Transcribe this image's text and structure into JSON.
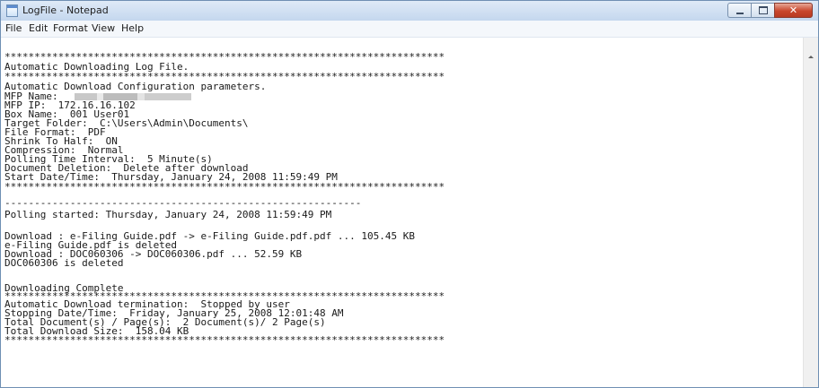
{
  "window": {
    "title": "LogFile - Notepad",
    "caption_buttons": {
      "minimize": "minimize-icon",
      "maximize": "maximize-icon",
      "close": "✕"
    }
  },
  "menu": [
    "File",
    "Edit",
    "Format",
    "View",
    "Help"
  ],
  "editor": {
    "lines": [
      "**************************************************************************",
      "Automatic Downloading Log File.",
      "**************************************************************************",
      "Automatic Download Configuration parameters.",
      "MFP Name:",
      "MFP IP:  172.16.16.102",
      "Box Name:  001 User01",
      "Target Folder:  C:\\Users\\Admin\\Documents\\",
      "File Format:  PDF",
      "Shrink To Half:  ON",
      "Compression:  Normal",
      "Polling Time Interval:  5 Minute(s)",
      "Document Deletion:  Delete after download",
      "Start Date/Time:  Thursday, January 24, 2008 11:59:49 PM",
      "**************************************************************************",
      "------------------------------------------------------------",
      "Polling started: Thursday, January 24, 2008 11:59:49 PM",
      "",
      "Download : e-Filing Guide.pdf -> e-Filing Guide.pdf.pdf ... 105.45 KB",
      "e-Filing Guide.pdf is deleted",
      "Download : DOC060306 -> DOC060306.pdf ... 52.59 KB",
      "DOC060306 is deleted",
      "",
      "Downloading Complete",
      "**************************************************************************",
      "Automatic Download termination:  Stopped by user",
      "Stopping Date/Time:  Friday, January 25, 2008 12:01:48 AM",
      "Total Document(s) / Page(s):  2 Document(s)/ 2 Page(s)",
      "Total Download Size:  158.04 KB",
      "**************************************************************************"
    ]
  },
  "icons": {
    "app": "notepad-icon",
    "scroll_up": "scroll-up-arrow-icon"
  },
  "colors": {
    "titlebar": "#c4d7ee",
    "close_button": "#c9462c",
    "text": "#1a1a1a"
  }
}
